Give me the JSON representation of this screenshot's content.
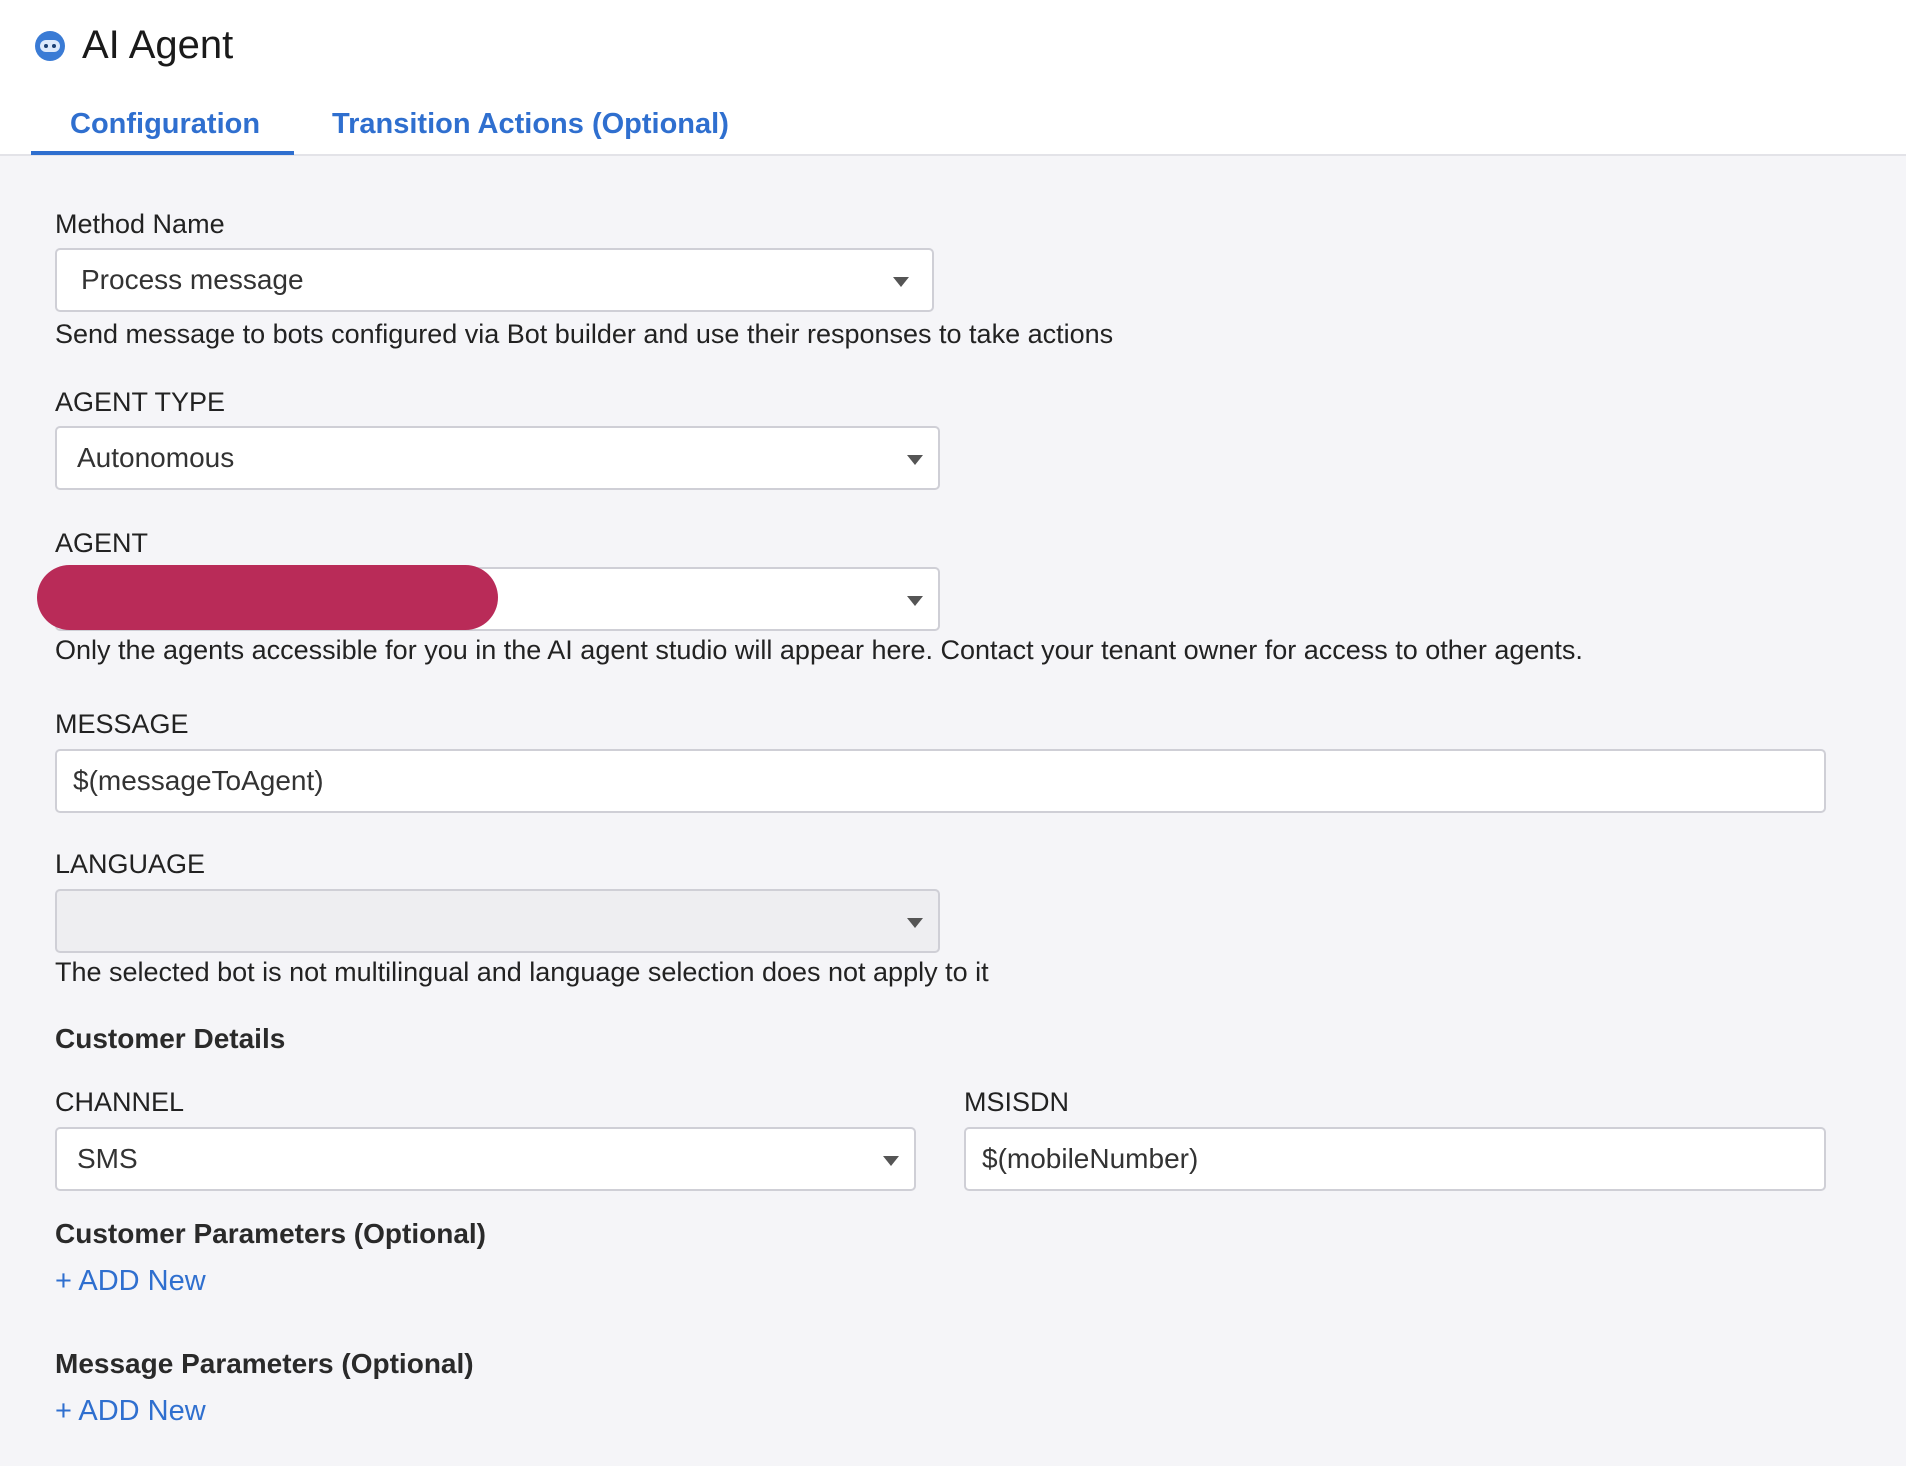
{
  "app": {
    "title": "AI Agent",
    "icon": "bot-icon"
  },
  "tabs": [
    {
      "label": "Configuration",
      "active": true
    },
    {
      "label": "Transition Actions (Optional)",
      "active": false
    }
  ],
  "form": {
    "method_name": {
      "label": "Method Name",
      "value": "Process message",
      "help": "Send message to bots configured via Bot builder and use their responses to take actions"
    },
    "agent_type": {
      "label": "AGENT TYPE",
      "value": "Autonomous"
    },
    "agent": {
      "label": "AGENT",
      "value": "",
      "help": "Only the agents accessible for you in the AI agent studio will appear here. Contact your tenant owner for access to other agents."
    },
    "message": {
      "label": "MESSAGE",
      "value": "$(messageToAgent)"
    },
    "language": {
      "label": "LANGUAGE",
      "value": "",
      "help": "The selected bot is not multilingual and language selection does not apply to it"
    },
    "customer_details": {
      "title": "Customer Details",
      "channel": {
        "label": "CHANNEL",
        "value": "SMS"
      },
      "msisdn": {
        "label": "MSISDN",
        "value": "$(mobileNumber)"
      }
    },
    "customer_parameters": {
      "title": "Customer Parameters (Optional)",
      "add_label": "+ ADD New"
    },
    "message_parameters": {
      "title": "Message Parameters (Optional)",
      "add_label": "+ ADD New"
    }
  },
  "colors": {
    "accent": "#2f6fcf",
    "redaction": "#b92b58",
    "background": "#f5f5f8"
  }
}
